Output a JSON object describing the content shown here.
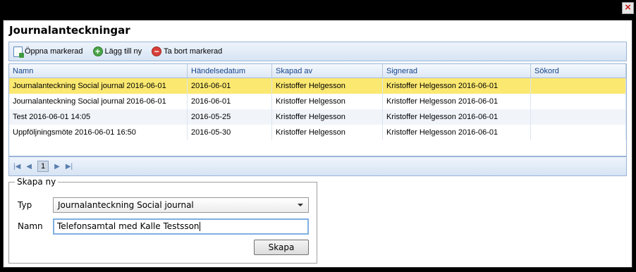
{
  "window": {
    "close_label": "×"
  },
  "dialog": {
    "title": "Journalanteckningar"
  },
  "toolbar": {
    "open_label": "Öppna markerad",
    "add_label": "Lägg till ny",
    "delete_label": "Ta bort markerad"
  },
  "grid": {
    "columns": [
      "Namn",
      "Händelsedatum",
      "Skapad av",
      "Signerad",
      "Sökord"
    ],
    "rows": [
      [
        "Journalanteckning Social journal 2016-06-01",
        "2016-06-01",
        "Kristoffer Helgesson",
        "Kristoffer Helgesson 2016-06-01",
        ""
      ],
      [
        "Journalanteckning Social journal 2016-06-01",
        "2016-06-01",
        "Kristoffer Helgesson",
        "Kristoffer Helgesson 2016-06-01",
        ""
      ],
      [
        "Test 2016-06-01 14:05",
        "2016-05-25",
        "Kristoffer Helgesson",
        "Kristoffer Helgesson 2016-06-01",
        ""
      ],
      [
        "Uppföljningsmöte 2016-06-01 16:50",
        "2016-05-30",
        "Kristoffer Helgesson",
        "Kristoffer Helgesson 2016-06-01",
        ""
      ]
    ],
    "selected_row": 0
  },
  "pager": {
    "first": "|◀",
    "prev": "◀",
    "page": "1",
    "next": "▶",
    "last": "▶|"
  },
  "create": {
    "legend": "Skapa ny",
    "type_label": "Typ",
    "type_value": "Journalanteckning Social journal",
    "name_label": "Namn",
    "name_value": "Telefonsamtal med Kalle Testsson",
    "submit_label": "Skapa"
  },
  "colors": {
    "selected_row": "#fbe870",
    "toolbar": "#dce7f5",
    "border": "#99b4d6"
  }
}
